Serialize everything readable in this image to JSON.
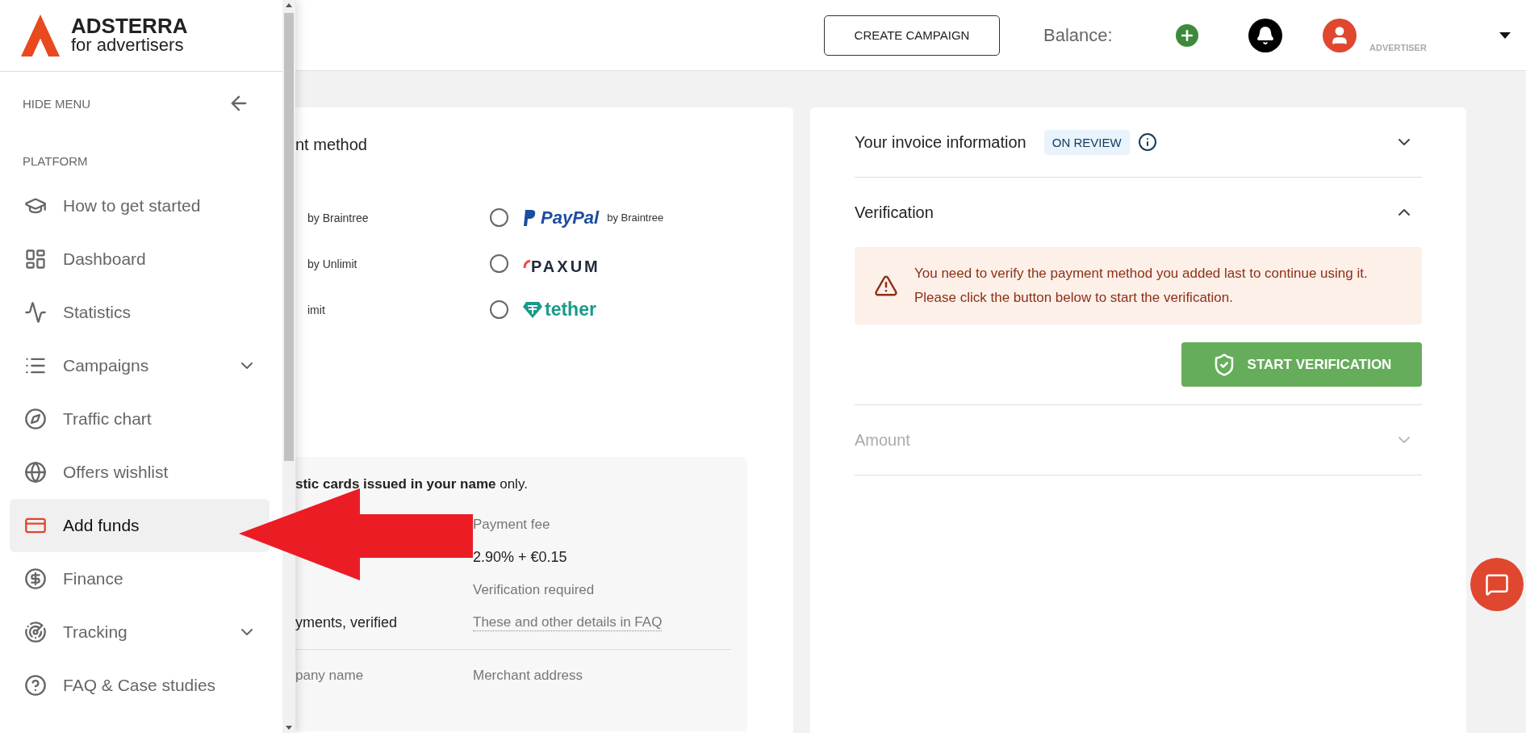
{
  "brand": {
    "name": "ADSTERRA",
    "tagline": "for advertisers"
  },
  "sidebar": {
    "hide_menu": "HIDE MENU",
    "section": "PLATFORM",
    "items": [
      {
        "label": "How to get started",
        "selected": false,
        "expandable": false
      },
      {
        "label": "Dashboard",
        "selected": false,
        "expandable": false
      },
      {
        "label": "Statistics",
        "selected": false,
        "expandable": false
      },
      {
        "label": "Campaigns",
        "selected": false,
        "expandable": true
      },
      {
        "label": "Traffic chart",
        "selected": false,
        "expandable": false
      },
      {
        "label": "Offers wishlist",
        "selected": false,
        "expandable": false
      },
      {
        "label": "Add funds",
        "selected": true,
        "expandable": false
      },
      {
        "label": "Finance",
        "selected": false,
        "expandable": false
      },
      {
        "label": "Tracking",
        "selected": false,
        "expandable": true
      },
      {
        "label": "FAQ & Case studies",
        "selected": false,
        "expandable": false
      }
    ]
  },
  "topbar": {
    "create_button": "CREATE CAMPAIGN",
    "balance_label": "Balance:",
    "role": "ADVERTISER"
  },
  "payment_panel": {
    "title": "nt method",
    "methods": [
      {
        "left_text": "by Braintree",
        "kind": "paypal",
        "logo": "PayPal",
        "suffix": "by Braintree",
        "selected": false
      },
      {
        "left_text": "by Unlimit",
        "kind": "paxum",
        "logo": "PAXUM",
        "selected": false
      },
      {
        "left_text": "imit",
        "kind": "tether",
        "logo": "tether",
        "selected": false
      }
    ],
    "info_box": {
      "note": "**stic cards issued in your name** only.",
      "fee_label": "Payment fee",
      "fee_value": "2.90% + €0.15",
      "verification_label": "Verification required",
      "left_value": "yments, verified",
      "faq_link": "These and other details in FAQ",
      "company_label": "pany name",
      "merchant_label": "Merchant address"
    }
  },
  "invoice_panel": {
    "sections": [
      {
        "title": "Your invoice information",
        "badge": "ON REVIEW",
        "expanded": false,
        "disabled": false
      },
      {
        "title": "Verification",
        "expanded": true,
        "disabled": false
      },
      {
        "title": "Amount",
        "expanded": false,
        "disabled": true
      }
    ],
    "alert": "You need to verify the payment method you added last to continue using it. Please click the button below to start the verification.",
    "button": "START VERIFICATION"
  }
}
